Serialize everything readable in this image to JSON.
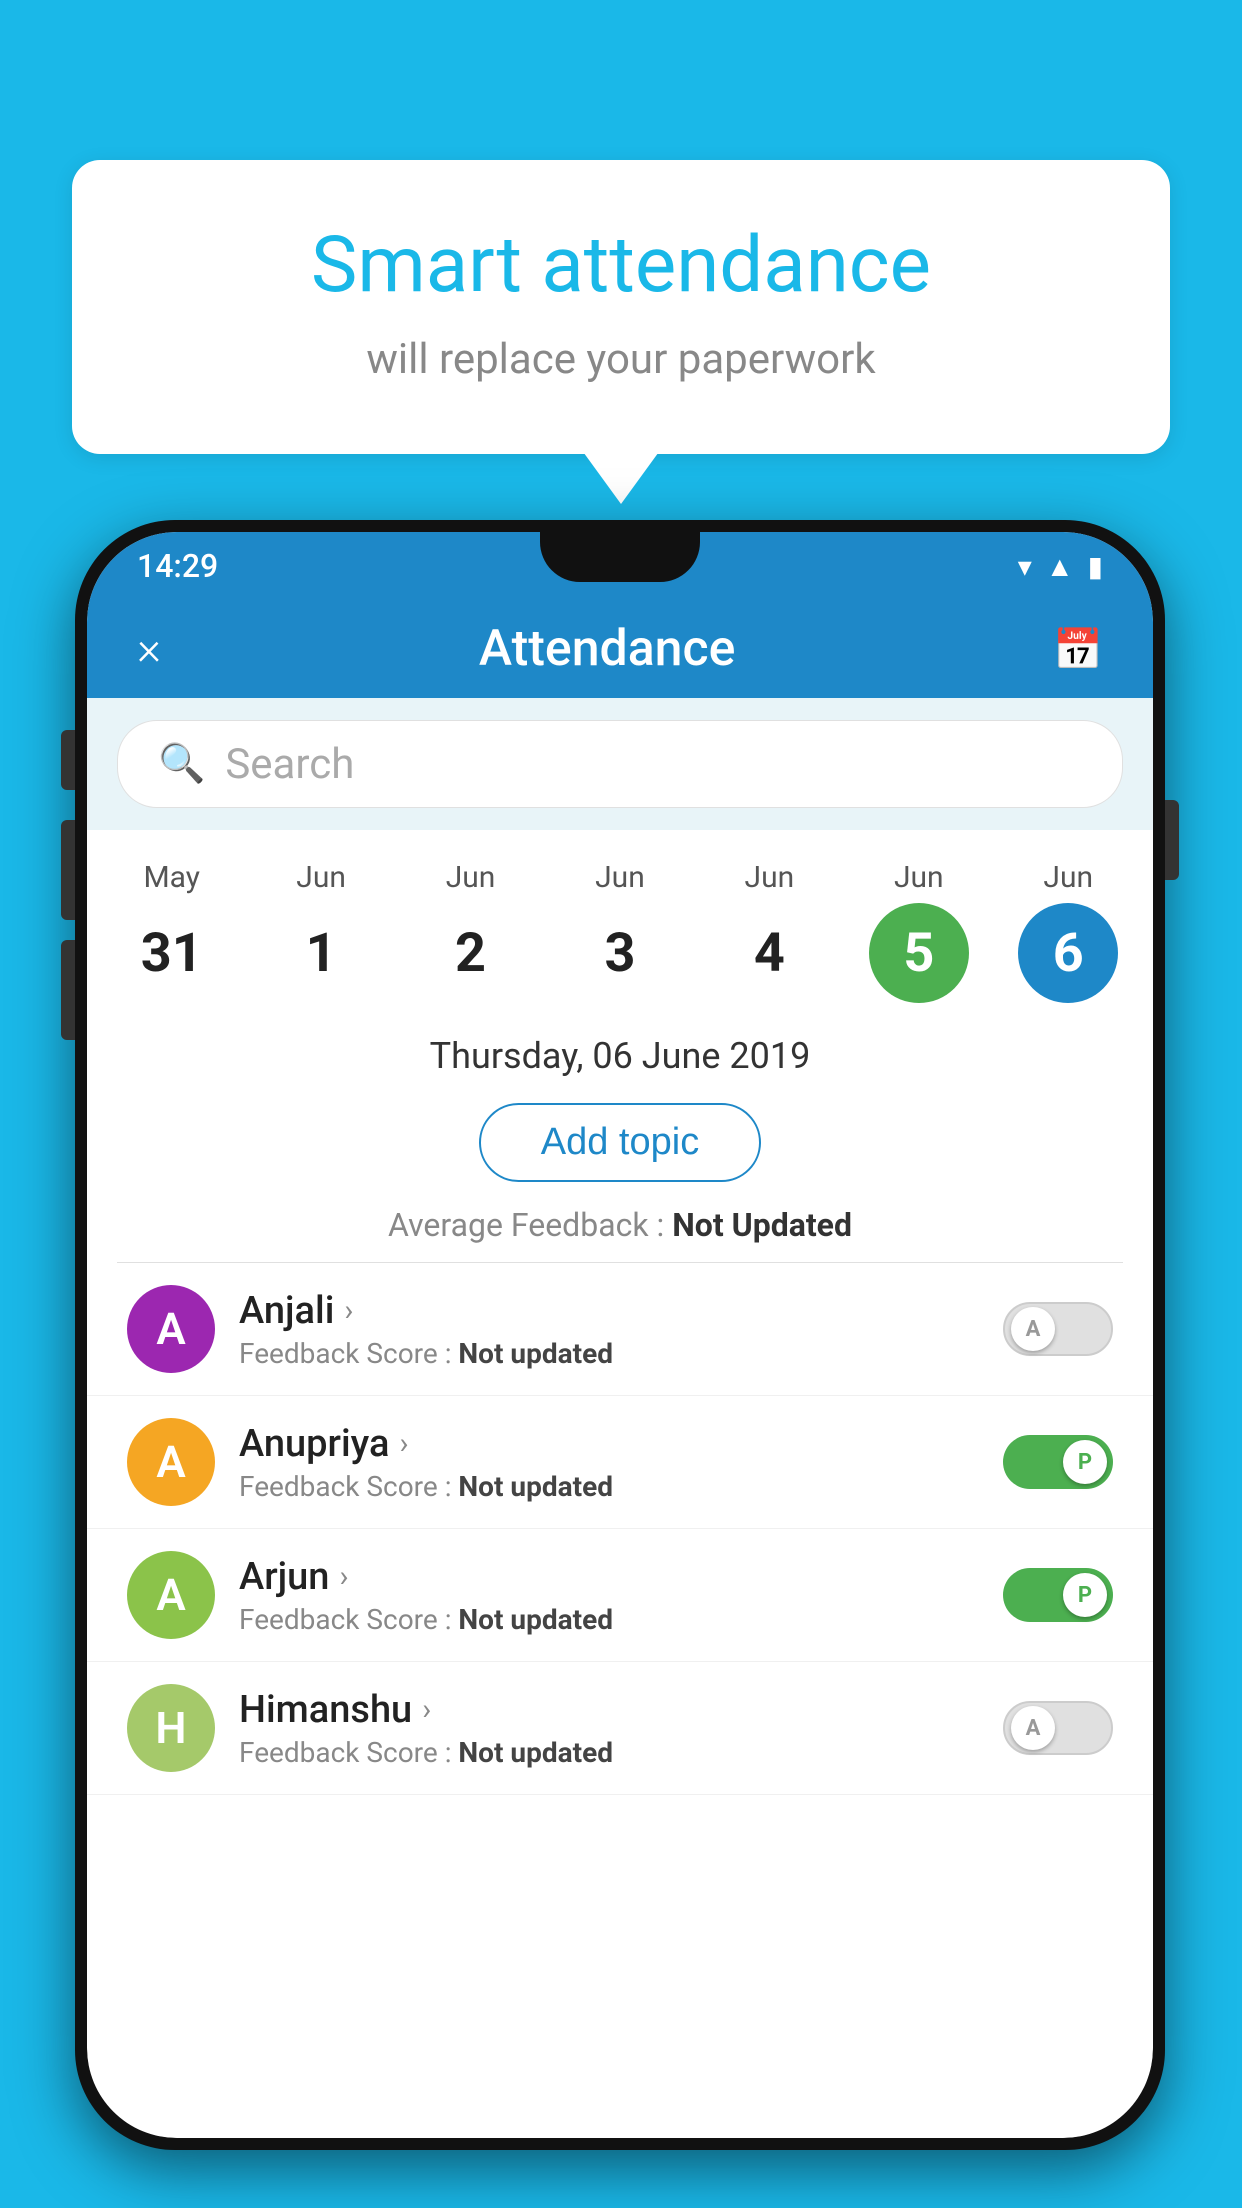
{
  "background_color": "#1ab8e8",
  "bubble": {
    "title": "Smart attendance",
    "subtitle": "will replace your paperwork"
  },
  "status_bar": {
    "time": "14:29"
  },
  "header": {
    "title": "Attendance",
    "close_label": "×",
    "calendar_icon": "calendar-icon"
  },
  "search": {
    "placeholder": "Search"
  },
  "dates": [
    {
      "month": "May",
      "day": "31",
      "variant": "normal"
    },
    {
      "month": "Jun",
      "day": "1",
      "variant": "normal"
    },
    {
      "month": "Jun",
      "day": "2",
      "variant": "normal"
    },
    {
      "month": "Jun",
      "day": "3",
      "variant": "normal"
    },
    {
      "month": "Jun",
      "day": "4",
      "variant": "normal"
    },
    {
      "month": "Jun",
      "day": "5",
      "variant": "today"
    },
    {
      "month": "Jun",
      "day": "6",
      "variant": "selected"
    }
  ],
  "selected_date_label": "Thursday, 06 June 2019",
  "add_topic_label": "Add topic",
  "average_feedback": {
    "label": "Average Feedback : ",
    "value": "Not Updated"
  },
  "students": [
    {
      "name": "Anjali",
      "avatar_letter": "A",
      "avatar_color": "#9c27b0",
      "feedback_label": "Feedback Score : ",
      "feedback_value": "Not updated",
      "toggle_state": "off",
      "toggle_letter": "A"
    },
    {
      "name": "Anupriya",
      "avatar_letter": "A",
      "avatar_color": "#f5a623",
      "feedback_label": "Feedback Score : ",
      "feedback_value": "Not updated",
      "toggle_state": "on",
      "toggle_letter": "P"
    },
    {
      "name": "Arjun",
      "avatar_letter": "A",
      "avatar_color": "#8bc34a",
      "feedback_label": "Feedback Score : ",
      "feedback_value": "Not updated",
      "toggle_state": "on",
      "toggle_letter": "P"
    },
    {
      "name": "Himanshu",
      "avatar_letter": "H",
      "avatar_color": "#a5c96a",
      "feedback_label": "Feedback Score : ",
      "feedback_value": "Not updated",
      "toggle_state": "off",
      "toggle_letter": "A"
    }
  ]
}
